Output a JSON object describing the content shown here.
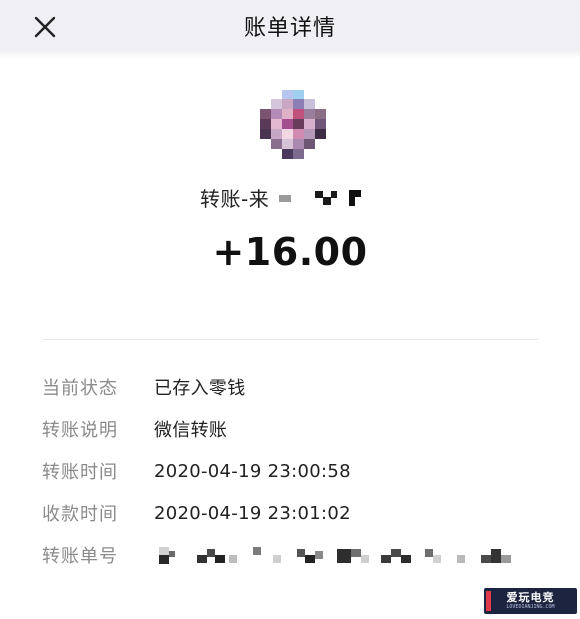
{
  "header": {
    "title": "账单详情",
    "close_icon": "close-icon"
  },
  "payer": {
    "avatar_icon": "pixelated-avatar",
    "transfer_prefix": "转账-来"
  },
  "amount": "+16.00",
  "details": [
    {
      "label": "当前状态",
      "value": "已存入零钱"
    },
    {
      "label": "转账说明",
      "value": "微信转账"
    },
    {
      "label": "转账时间",
      "value": "2020-04-19 23:00:58"
    },
    {
      "label": "收款时间",
      "value": "2020-04-19 23:01:02"
    },
    {
      "label": "转账单号",
      "value": ""
    }
  ],
  "watermark": {
    "text": "爱玩电竞",
    "sub": "LOVEDIANJING.COM"
  },
  "colors": {
    "nav_bg": "#efeff4",
    "label": "#8a8a8a",
    "text": "#222222"
  }
}
